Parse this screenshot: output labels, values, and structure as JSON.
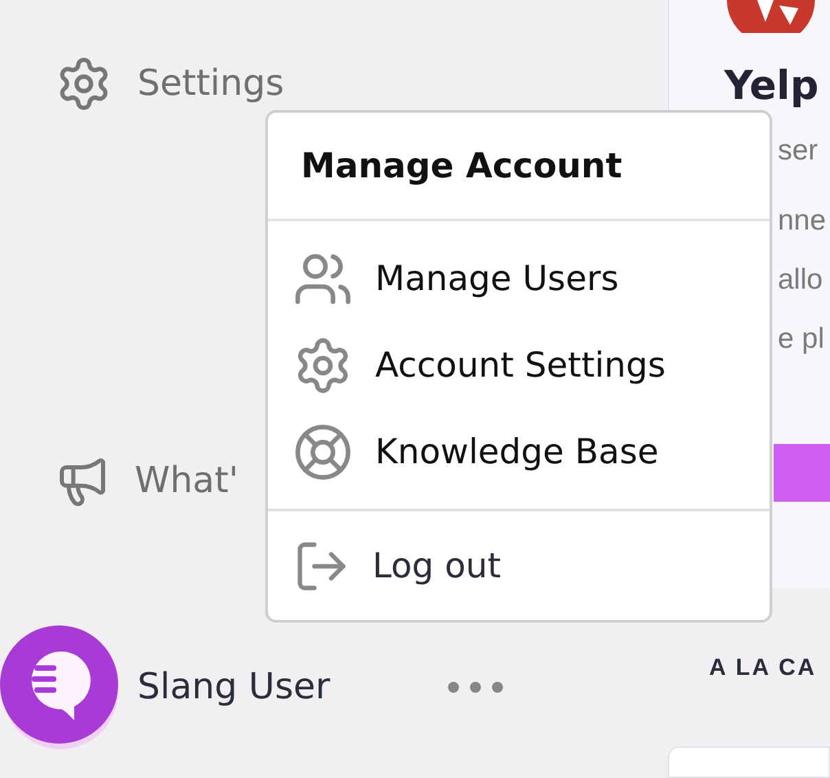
{
  "sidebar": {
    "items": [
      {
        "label": "Settings",
        "kind": "settings"
      },
      {
        "label": "What'",
        "kind": "announcements"
      }
    ],
    "user": {
      "name": "Slang User"
    }
  },
  "card": {
    "title": "Yelp",
    "subtitle": "ser",
    "description_lines": [
      "nne",
      "allo",
      "e pl"
    ]
  },
  "section_heading": "A LA CA",
  "menu": {
    "title": "Manage Account",
    "items": [
      {
        "label": "Manage Users",
        "kind": "users"
      },
      {
        "label": "Account Settings",
        "kind": "settings"
      },
      {
        "label": "Knowledge Base",
        "kind": "help"
      }
    ],
    "footer_items": [
      {
        "label": "Log out",
        "kind": "logout"
      }
    ]
  }
}
